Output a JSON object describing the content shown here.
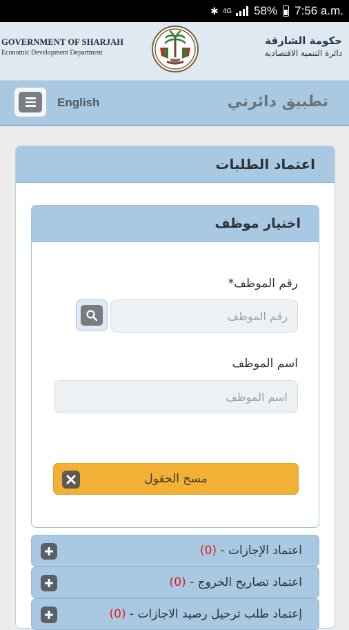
{
  "status_bar": {
    "battery": "58%",
    "time": "7:56 a.m.",
    "network": "4G"
  },
  "gov_header": {
    "en_line1": "GOVERNMENT OF SHARJAH",
    "en_line2": "Economic Development Department",
    "ar_line1": "حكومة الشارقة",
    "ar_line2": "دائرة التنمية الاقتصادية"
  },
  "app_bar": {
    "language_link": "English",
    "title": "تطبيق دائرتي"
  },
  "main_card": {
    "title": "اعتماد الطلبات"
  },
  "employee_panel": {
    "title": "اختيار موظف",
    "employee_number_label": "رقم الموظف*",
    "employee_number_placeholder": "رقم الموظف",
    "employee_name_label": "اسم الموظف",
    "employee_name_placeholder": "اسم الموظف",
    "clear_button": "مسح الحقول"
  },
  "accordion": [
    {
      "label": "اعتماد الإجازات -",
      "count": "(0)"
    },
    {
      "label": "اعتماد تصاريح الخروج -",
      "count": "(0)"
    },
    {
      "label": "إعتماد طلب ترحيل رصيد الاجازات -",
      "count": "(0)"
    }
  ]
}
